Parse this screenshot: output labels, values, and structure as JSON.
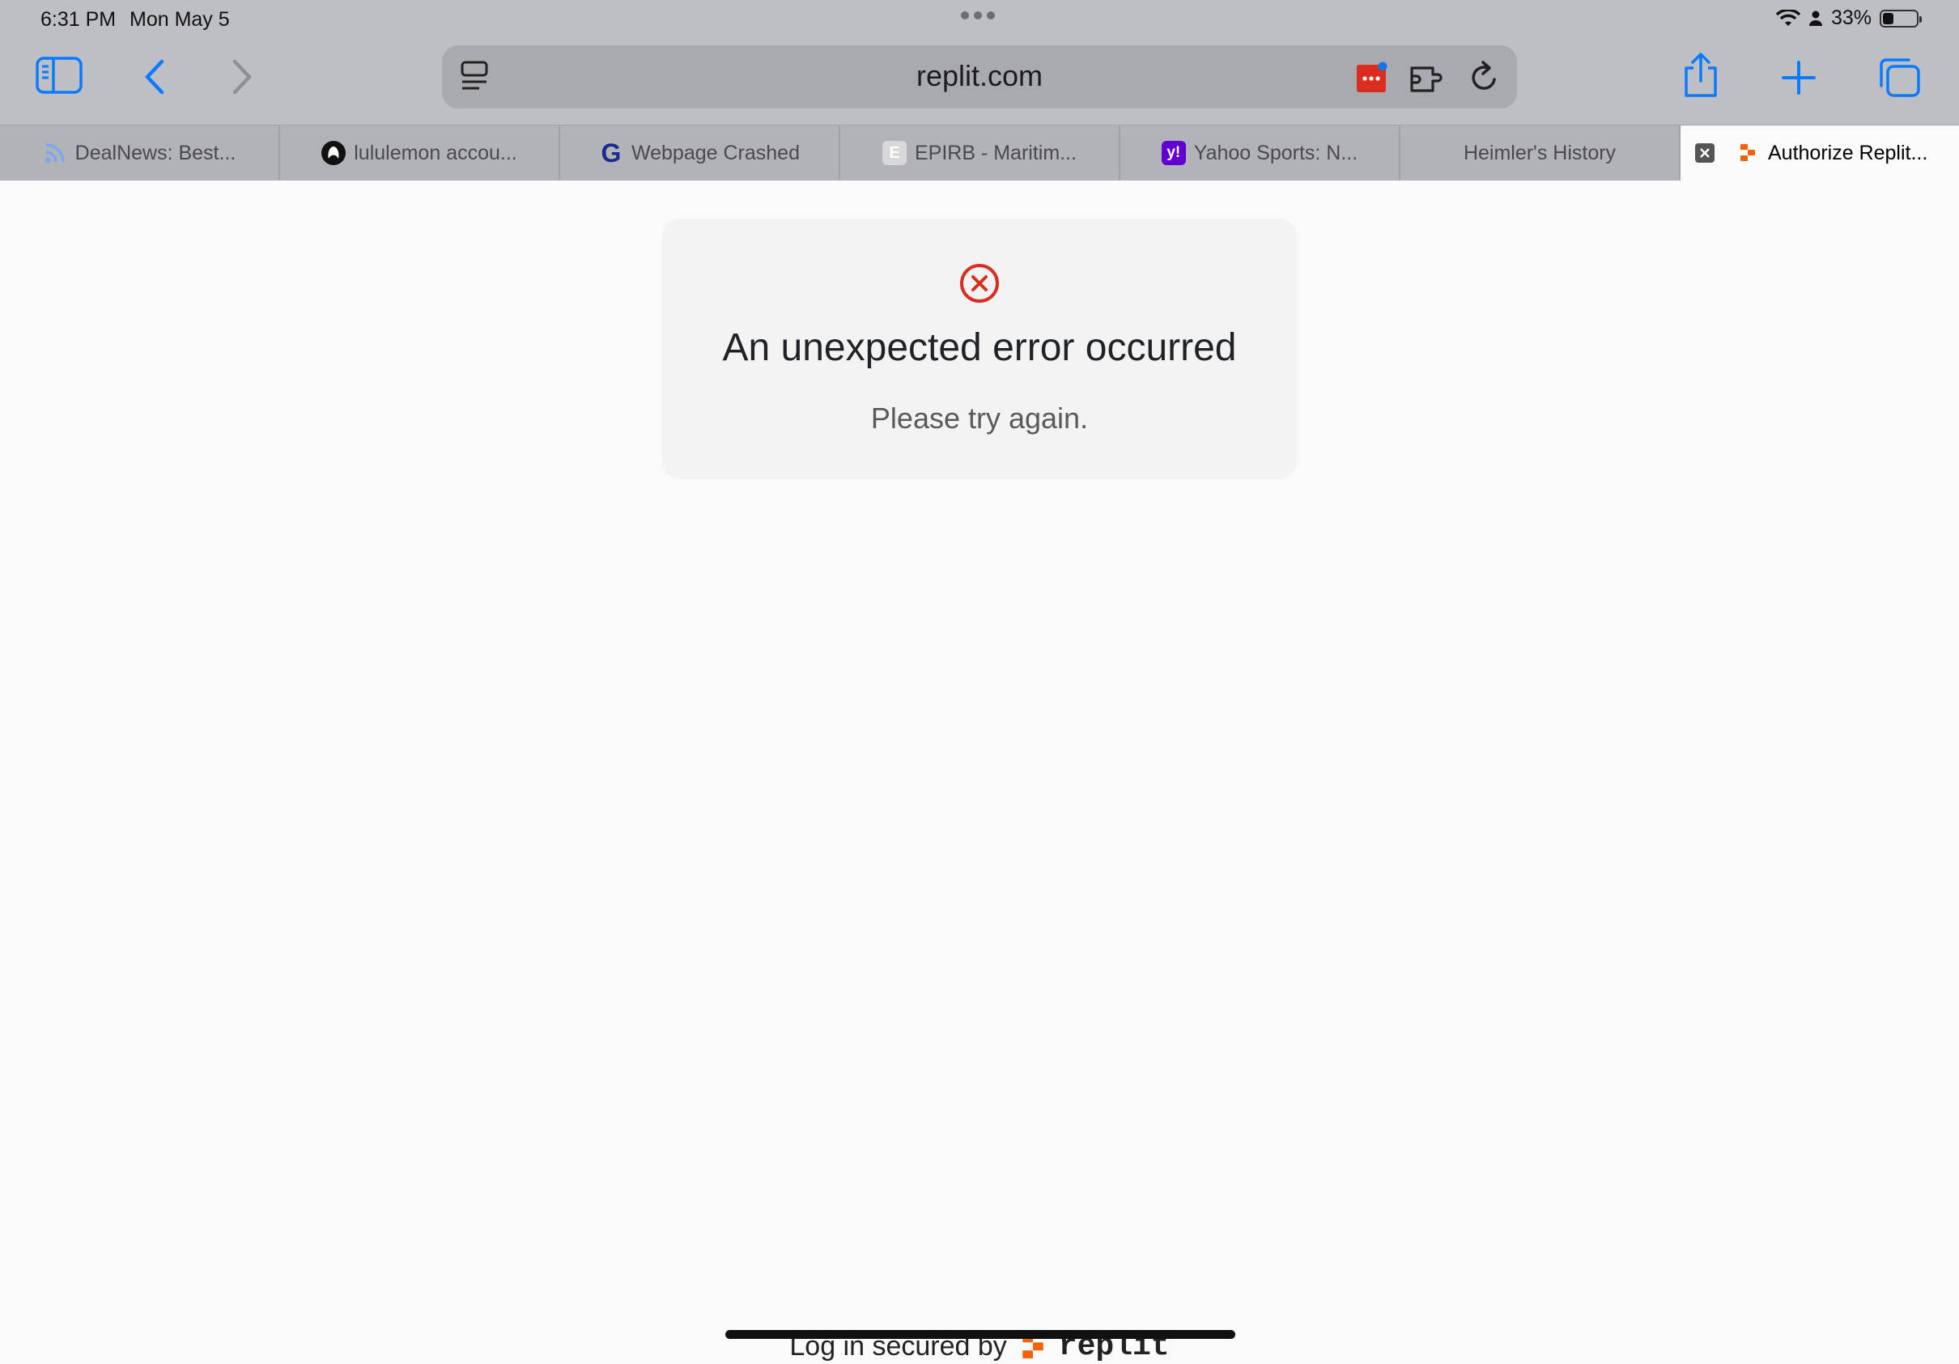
{
  "status": {
    "time": "6:31 PM",
    "date": "Mon May 5",
    "battery": "33%",
    "battery_level": 0.33
  },
  "toolbar": {
    "url": "replit.com"
  },
  "tabs": [
    {
      "label": "DealNews: Best...",
      "icon": "rss-icon"
    },
    {
      "label": "lululemon accou...",
      "icon": "lululemon-logo-icon"
    },
    {
      "label": "Webpage Crashed",
      "icon": "google-g-icon"
    },
    {
      "label": "EPIRB - Maritim...",
      "icon": "letter-e-icon",
      "icon_text": "E"
    },
    {
      "label": "Yahoo Sports: N...",
      "icon": "yahoo-icon",
      "icon_text": "y!"
    },
    {
      "label": "Heimler's History",
      "icon": ""
    },
    {
      "label": "Authorize Replit...",
      "icon": "replit-icon",
      "active": true
    }
  ],
  "error": {
    "title": "An unexpected error occurred",
    "message": "Please try again."
  },
  "footer": {
    "text": "Log in secured by",
    "brand": "replit"
  },
  "colors": {
    "accent": "#0a7aff",
    "error": "#d92d20",
    "replit_orange": "#f26207",
    "yahoo_purple": "#6001d2"
  }
}
